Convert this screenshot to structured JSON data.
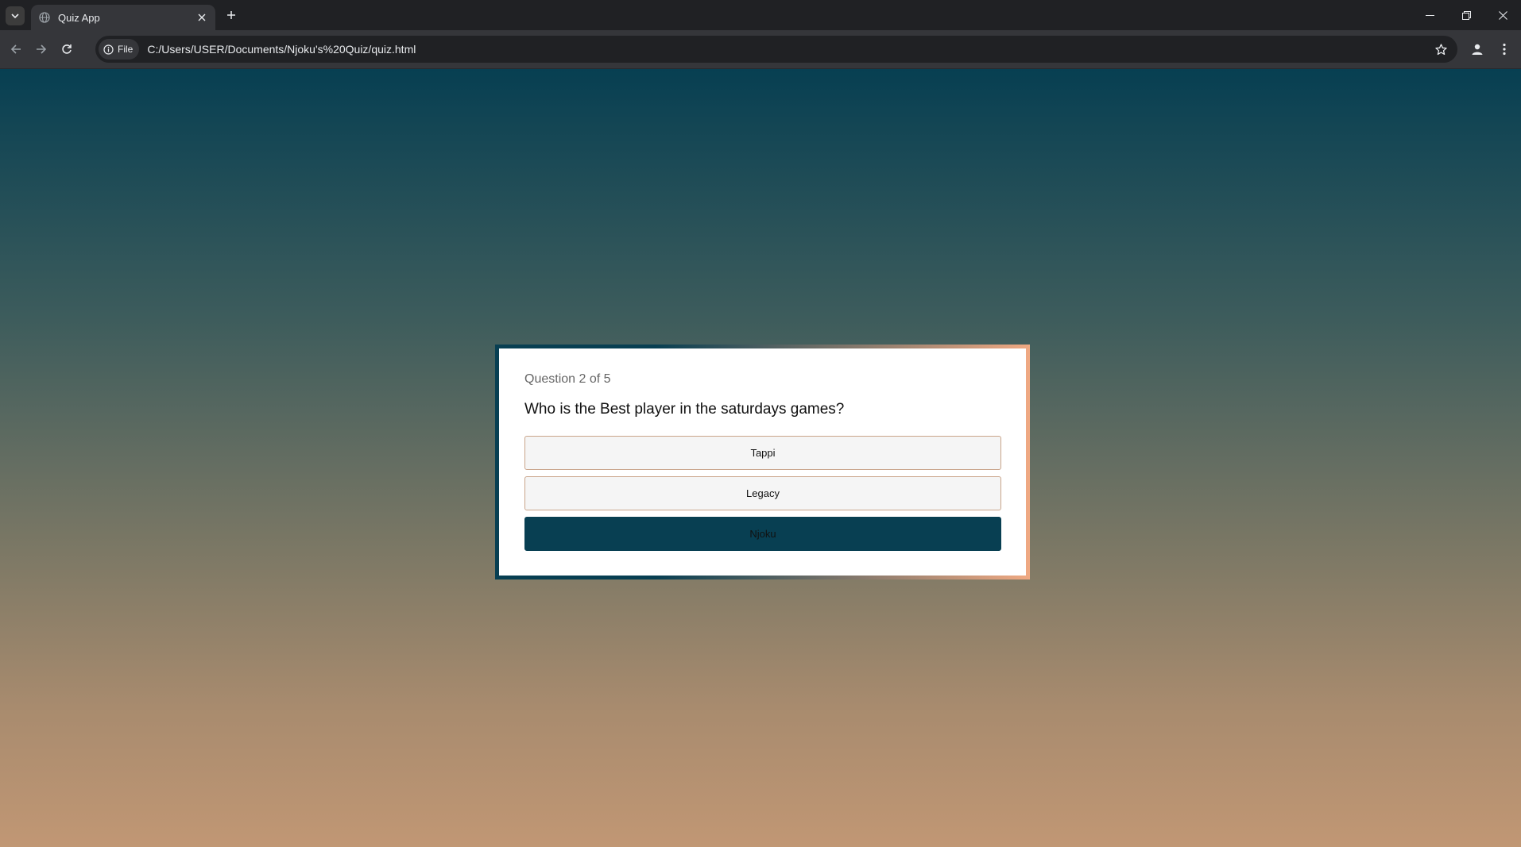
{
  "browser": {
    "tab": {
      "title": "Quiz App"
    },
    "address": {
      "chip_label": "File",
      "url": "C:/Users/USER/Documents/Njoku's%20Quiz/quiz.html"
    }
  },
  "quiz": {
    "counter": "Question 2 of 5",
    "question": "Who is the Best player in the saturdays games?",
    "answers": [
      {
        "label": "Tappi",
        "selected": false
      },
      {
        "label": "Legacy",
        "selected": false
      },
      {
        "label": "Njoku",
        "selected": true
      }
    ]
  },
  "colors": {
    "gradient_top": "#073f52",
    "gradient_bottom": "#c19774",
    "frame_left": "#083f52",
    "frame_right": "#f0a982",
    "selected_answer": "#083f52"
  },
  "icons": [
    "tab-search-icon",
    "globe-icon",
    "close-icon",
    "plus-icon",
    "minimize-icon",
    "restore-icon",
    "back-icon",
    "forward-icon",
    "reload-icon",
    "info-icon",
    "star-icon",
    "profile-icon",
    "more-icon"
  ]
}
